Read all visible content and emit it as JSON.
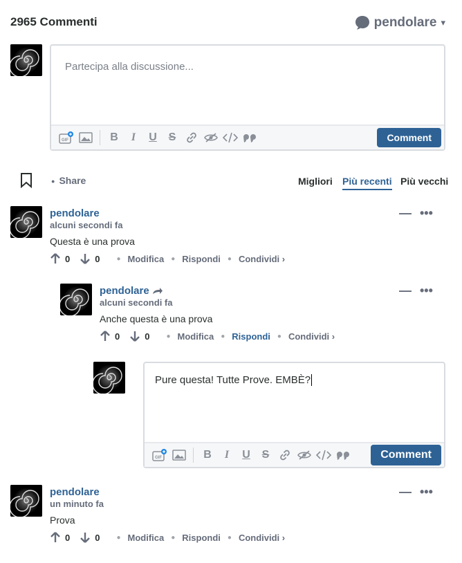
{
  "header": {
    "count": "2965 Commenti",
    "username": "pendolare",
    "chevron": "▾"
  },
  "composer_main": {
    "placeholder": "Partecipa alla discussione...",
    "button": "Comment"
  },
  "nav": {
    "share": "Share",
    "sort": [
      "Migliori",
      "Più recenti",
      "Più vecchi"
    ],
    "active_sort": "Più recenti"
  },
  "comments": [
    {
      "author": "pendolare",
      "time": "alcuni secondi fa",
      "body": "Questa è una prova",
      "up": "0",
      "down": "0",
      "actions": [
        "Modifica",
        "Rispondi",
        "Condividi ›"
      ]
    },
    {
      "author": "pendolare",
      "time": "alcuni secondi fa",
      "body": "Anche questa è una prova",
      "up": "0",
      "down": "0",
      "actions": [
        "Modifica",
        "Rispondi",
        "Condividi ›"
      ]
    },
    {
      "author": "pendolare",
      "time": "un minuto fa",
      "body": "Prova",
      "up": "0",
      "down": "0",
      "actions": [
        "Modifica",
        "Rispondi",
        "Condividi ›"
      ]
    }
  ],
  "composer_reply": {
    "value": "Pure questa! Tutte Prove. EMBÈ?",
    "button": "Comment"
  },
  "colors": {
    "accent": "#2e6295",
    "muted": "#656c7a",
    "border": "#d8dbdf"
  }
}
